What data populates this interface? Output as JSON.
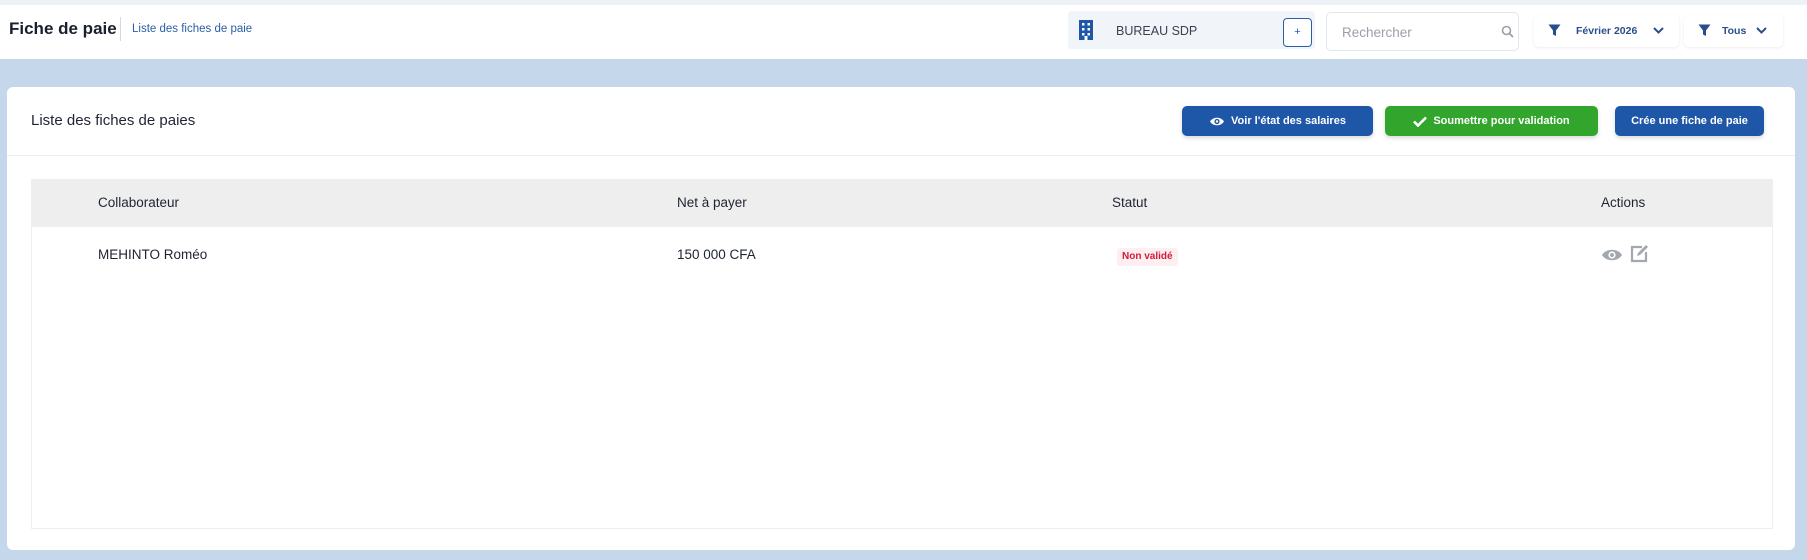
{
  "header": {
    "title": "Fiche de paie",
    "breadcrumb": "Liste des fiches de paie",
    "company": "BUREAU SDP",
    "add_label": "+",
    "search_placeholder": "Rechercher",
    "filter_period": "Février 2026",
    "filter_status": "Tous"
  },
  "card": {
    "title": "Liste des fiches de paies",
    "btn_view_salaries": "Voir l'état des salaires",
    "btn_submit": "Soumettre pour validation",
    "btn_create": "Crée une fiche de paie"
  },
  "table": {
    "columns": [
      "Collaborateur",
      "Net à payer",
      "Statut",
      "Actions"
    ],
    "rows": [
      {
        "employee": "MEHINTO Roméo",
        "net": "150 000 CFA",
        "status": "Non validé"
      }
    ]
  },
  "colors": {
    "primary": "#1e56a8",
    "success": "#31a52c",
    "danger": "#d11a38",
    "background": "#c5d7ea"
  }
}
